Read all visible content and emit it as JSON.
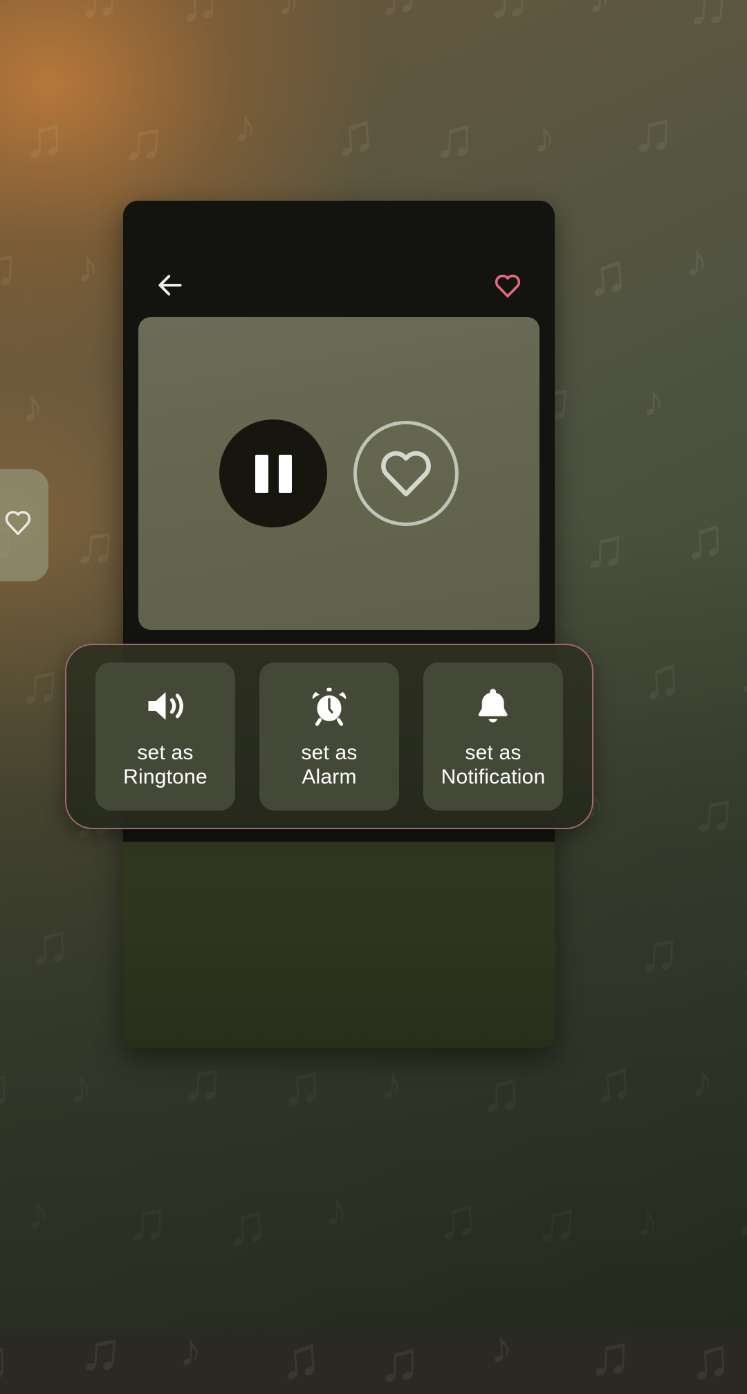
{
  "screen": {
    "title": "Music player — set as ringtone sheet",
    "background_colors": {
      "warm_highlight": "#c47c3a",
      "olive_base": "#454b38",
      "dark_green": "#2d351e"
    }
  },
  "wallpaper": {
    "pattern_glyph": "♫",
    "pattern_glyph_alt": "♪",
    "note_opacity": "0.075"
  },
  "side_card": {
    "name": "partially-visible-favorite-card",
    "icon": "heart-outline-icon",
    "color": "#989e83"
  },
  "player": {
    "card_color": "#131310",
    "header": {
      "back_icon": "arrow-left-icon",
      "favorite_icon": "heart-outline-icon",
      "favorite_color": "#e8697f"
    },
    "album_art": {
      "color": "#64664f",
      "play_pause": {
        "icon": "pause-icon",
        "state": "playing",
        "circle_color": "#16160f",
        "bar_color": "#ffffff"
      },
      "favorite": {
        "icon": "heart-outline-icon",
        "ring_color": "#d6d8ce"
      }
    }
  },
  "actions_panel": {
    "border_color": "#9d6b6b",
    "tile_color": "#434936",
    "items": [
      {
        "icon": "volume-up-icon",
        "label_line1": "set as",
        "label_line2": "Ringtone"
      },
      {
        "icon": "alarm-clock-icon",
        "label_line1": "set as",
        "label_line2": "Alarm"
      },
      {
        "icon": "bell-icon",
        "label_line1": "set as",
        "label_line2": "Notification"
      }
    ]
  }
}
